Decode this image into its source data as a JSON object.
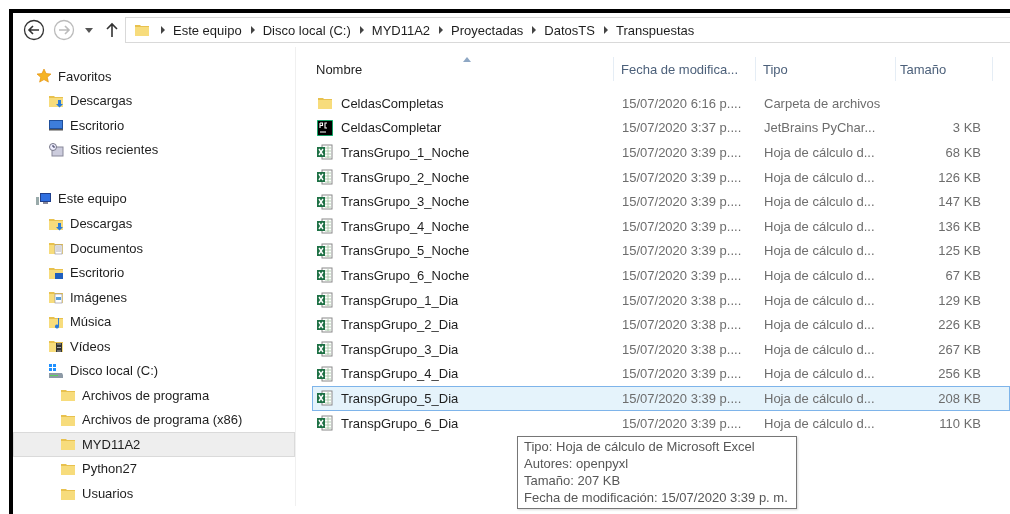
{
  "nav_buttons": [
    {
      "kind": "back",
      "disabled": false
    },
    {
      "kind": "forward",
      "disabled": true
    },
    {
      "kind": "recent",
      "disabled": false
    },
    {
      "kind": "up",
      "disabled": false
    }
  ],
  "address_bar": {
    "path": [
      "Este equipo",
      "Disco local (C:)",
      "MYD11A2",
      "Proyectadas",
      "DatosTS",
      "Transpuestas"
    ]
  },
  "nav_pane": {
    "sections": [
      {
        "label": "Favoritos",
        "kind": "star",
        "selected": false,
        "children": [
          {
            "label": "Descargas",
            "kind": "downloads",
            "selected": false
          },
          {
            "label": "Escritorio",
            "kind": "monitor",
            "selected": false
          },
          {
            "label": "Sitios recientes",
            "kind": "recent",
            "selected": false
          }
        ]
      },
      {
        "label": "Este equipo",
        "kind": "computer",
        "selected": false,
        "children": [
          {
            "label": "Descargas",
            "kind": "downloads",
            "selected": false
          },
          {
            "label": "Documentos",
            "kind": "documents",
            "selected": false
          },
          {
            "label": "Escritorio",
            "kind": "desktop",
            "selected": false
          },
          {
            "label": "Imágenes",
            "kind": "pictures",
            "selected": false
          },
          {
            "label": "Música",
            "kind": "music",
            "selected": false
          },
          {
            "label": "Vídeos",
            "kind": "videos",
            "selected": false
          },
          {
            "label": "Disco local (C:)",
            "kind": "drive",
            "selected": false,
            "children": [
              {
                "label": "Archivos de programa",
                "kind": "folder",
                "selected": false
              },
              {
                "label": "Archivos de programa (x86)",
                "kind": "folder",
                "selected": false
              },
              {
                "label": "MYD11A2",
                "kind": "folder",
                "selected": true
              },
              {
                "label": "Python27",
                "kind": "folder",
                "selected": false
              },
              {
                "label": "Usuarios",
                "kind": "folder",
                "selected": false
              }
            ]
          }
        ]
      }
    ]
  },
  "file_list": {
    "columns": [
      {
        "label": "Nombre",
        "sorted": true
      },
      {
        "label": "Fecha de modifica...",
        "sorted": false
      },
      {
        "label": "Tipo",
        "sorted": false
      },
      {
        "label": "Tamaño",
        "sorted": false
      }
    ],
    "rows": [
      {
        "name": "CeldasCompletas",
        "kind": "folder",
        "date": "15/07/2020 6:16 p....",
        "type": "Carpeta de archivos",
        "selected": false
      },
      {
        "name": "CeldasCompletar",
        "kind": "app",
        "date": "15/07/2020 3:37 p....",
        "type": "JetBrains PyChar...",
        "size": "3 KB",
        "selected": false
      },
      {
        "name": "TransGrupo_1_Noche",
        "kind": "sheet",
        "date": "15/07/2020 3:39 p....",
        "type": "Hoja de cálculo d...",
        "size": "68 KB",
        "selected": false
      },
      {
        "name": "TransGrupo_2_Noche",
        "kind": "sheet",
        "date": "15/07/2020 3:39 p....",
        "type": "Hoja de cálculo d...",
        "size": "126 KB",
        "selected": false
      },
      {
        "name": "TransGrupo_3_Noche",
        "kind": "sheet",
        "date": "15/07/2020 3:39 p....",
        "type": "Hoja de cálculo d...",
        "size": "147 KB",
        "selected": false
      },
      {
        "name": "TransGrupo_4_Noche",
        "kind": "sheet",
        "date": "15/07/2020 3:39 p....",
        "type": "Hoja de cálculo d...",
        "size": "136 KB",
        "selected": false
      },
      {
        "name": "TransGrupo_5_Noche",
        "kind": "sheet",
        "date": "15/07/2020 3:39 p....",
        "type": "Hoja de cálculo d...",
        "size": "125 KB",
        "selected": false
      },
      {
        "name": "TransGrupo_6_Noche",
        "kind": "sheet",
        "date": "15/07/2020 3:39 p....",
        "type": "Hoja de cálculo d...",
        "size": "67 KB",
        "selected": false
      },
      {
        "name": "TranspGrupo_1_Dia",
        "kind": "sheet",
        "date": "15/07/2020 3:38 p....",
        "type": "Hoja de cálculo d...",
        "size": "129 KB",
        "selected": false
      },
      {
        "name": "TranspGrupo_2_Dia",
        "kind": "sheet",
        "date": "15/07/2020 3:38 p....",
        "type": "Hoja de cálculo d...",
        "size": "226 KB",
        "selected": false
      },
      {
        "name": "TranspGrupo_3_Dia",
        "kind": "sheet",
        "date": "15/07/2020 3:38 p....",
        "type": "Hoja de cálculo d...",
        "size": "267 KB",
        "selected": false
      },
      {
        "name": "TranspGrupo_4_Dia",
        "kind": "sheet",
        "date": "15/07/2020 3:39 p....",
        "type": "Hoja de cálculo d...",
        "size": "256 KB",
        "selected": false
      },
      {
        "name": "TranspGrupo_5_Dia",
        "kind": "sheet",
        "date": "15/07/2020 3:39 p....",
        "type": "Hoja de cálculo d...",
        "size": "208 KB",
        "selected": true
      },
      {
        "name": "TranspGrupo_6_Dia",
        "kind": "sheet",
        "date": "15/07/2020 3:39 p....",
        "type": "Hoja de cálculo d...",
        "size": "110 KB",
        "selected": false
      }
    ]
  },
  "tooltip": {
    "lines": [
      "Tipo: Hoja de cálculo de Microsoft Excel",
      "Autores: openpyxl",
      "Tamaño: 207 KB",
      "Fecha de modificación: 15/07/2020 3:39 p. m."
    ]
  }
}
